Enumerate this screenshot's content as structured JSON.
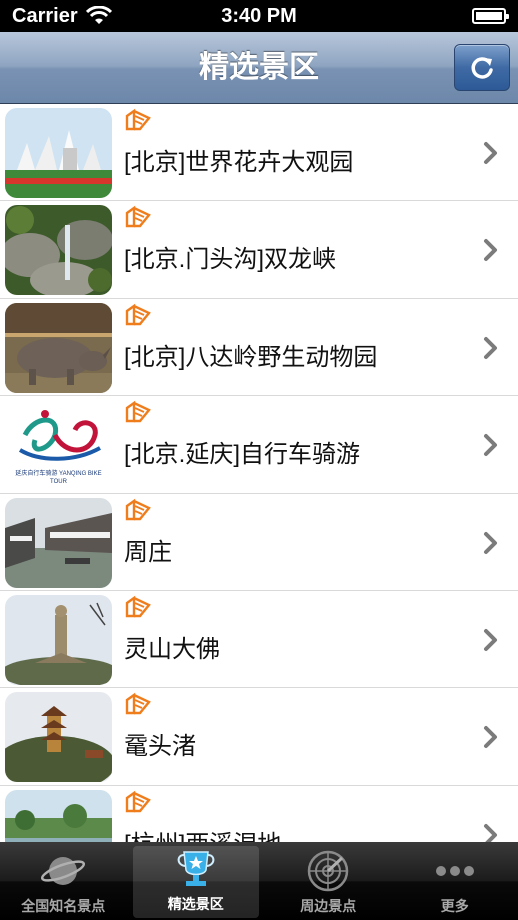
{
  "status": {
    "carrier": "Carrier",
    "time": "3:40 PM"
  },
  "nav": {
    "title": "精选景区"
  },
  "list": {
    "items": [
      {
        "label": "[北京]世界花卉大观园"
      },
      {
        "label": "[北京.门头沟]双龙峡"
      },
      {
        "label": "[北京]八达岭野生动物园"
      },
      {
        "label": "[北京.延庆]自行车骑游"
      },
      {
        "label": "周庄"
      },
      {
        "label": "灵山大佛"
      },
      {
        "label": "鼋头渚"
      },
      {
        "label": "[杭州]西溪湿地"
      }
    ],
    "logo_caption": "延庆自行车骑游 YANQING BIKE TOUR"
  },
  "tabs": [
    {
      "label": "全国知名景点",
      "icon": "planet-icon",
      "selected": false
    },
    {
      "label": "精选景区",
      "icon": "trophy-icon",
      "selected": true
    },
    {
      "label": "周边景点",
      "icon": "radar-icon",
      "selected": false
    },
    {
      "label": "更多",
      "icon": "more-icon",
      "selected": false
    }
  ],
  "colors": {
    "accent_orange": "#f07d1c",
    "nav_blue": "#7a93b4"
  }
}
